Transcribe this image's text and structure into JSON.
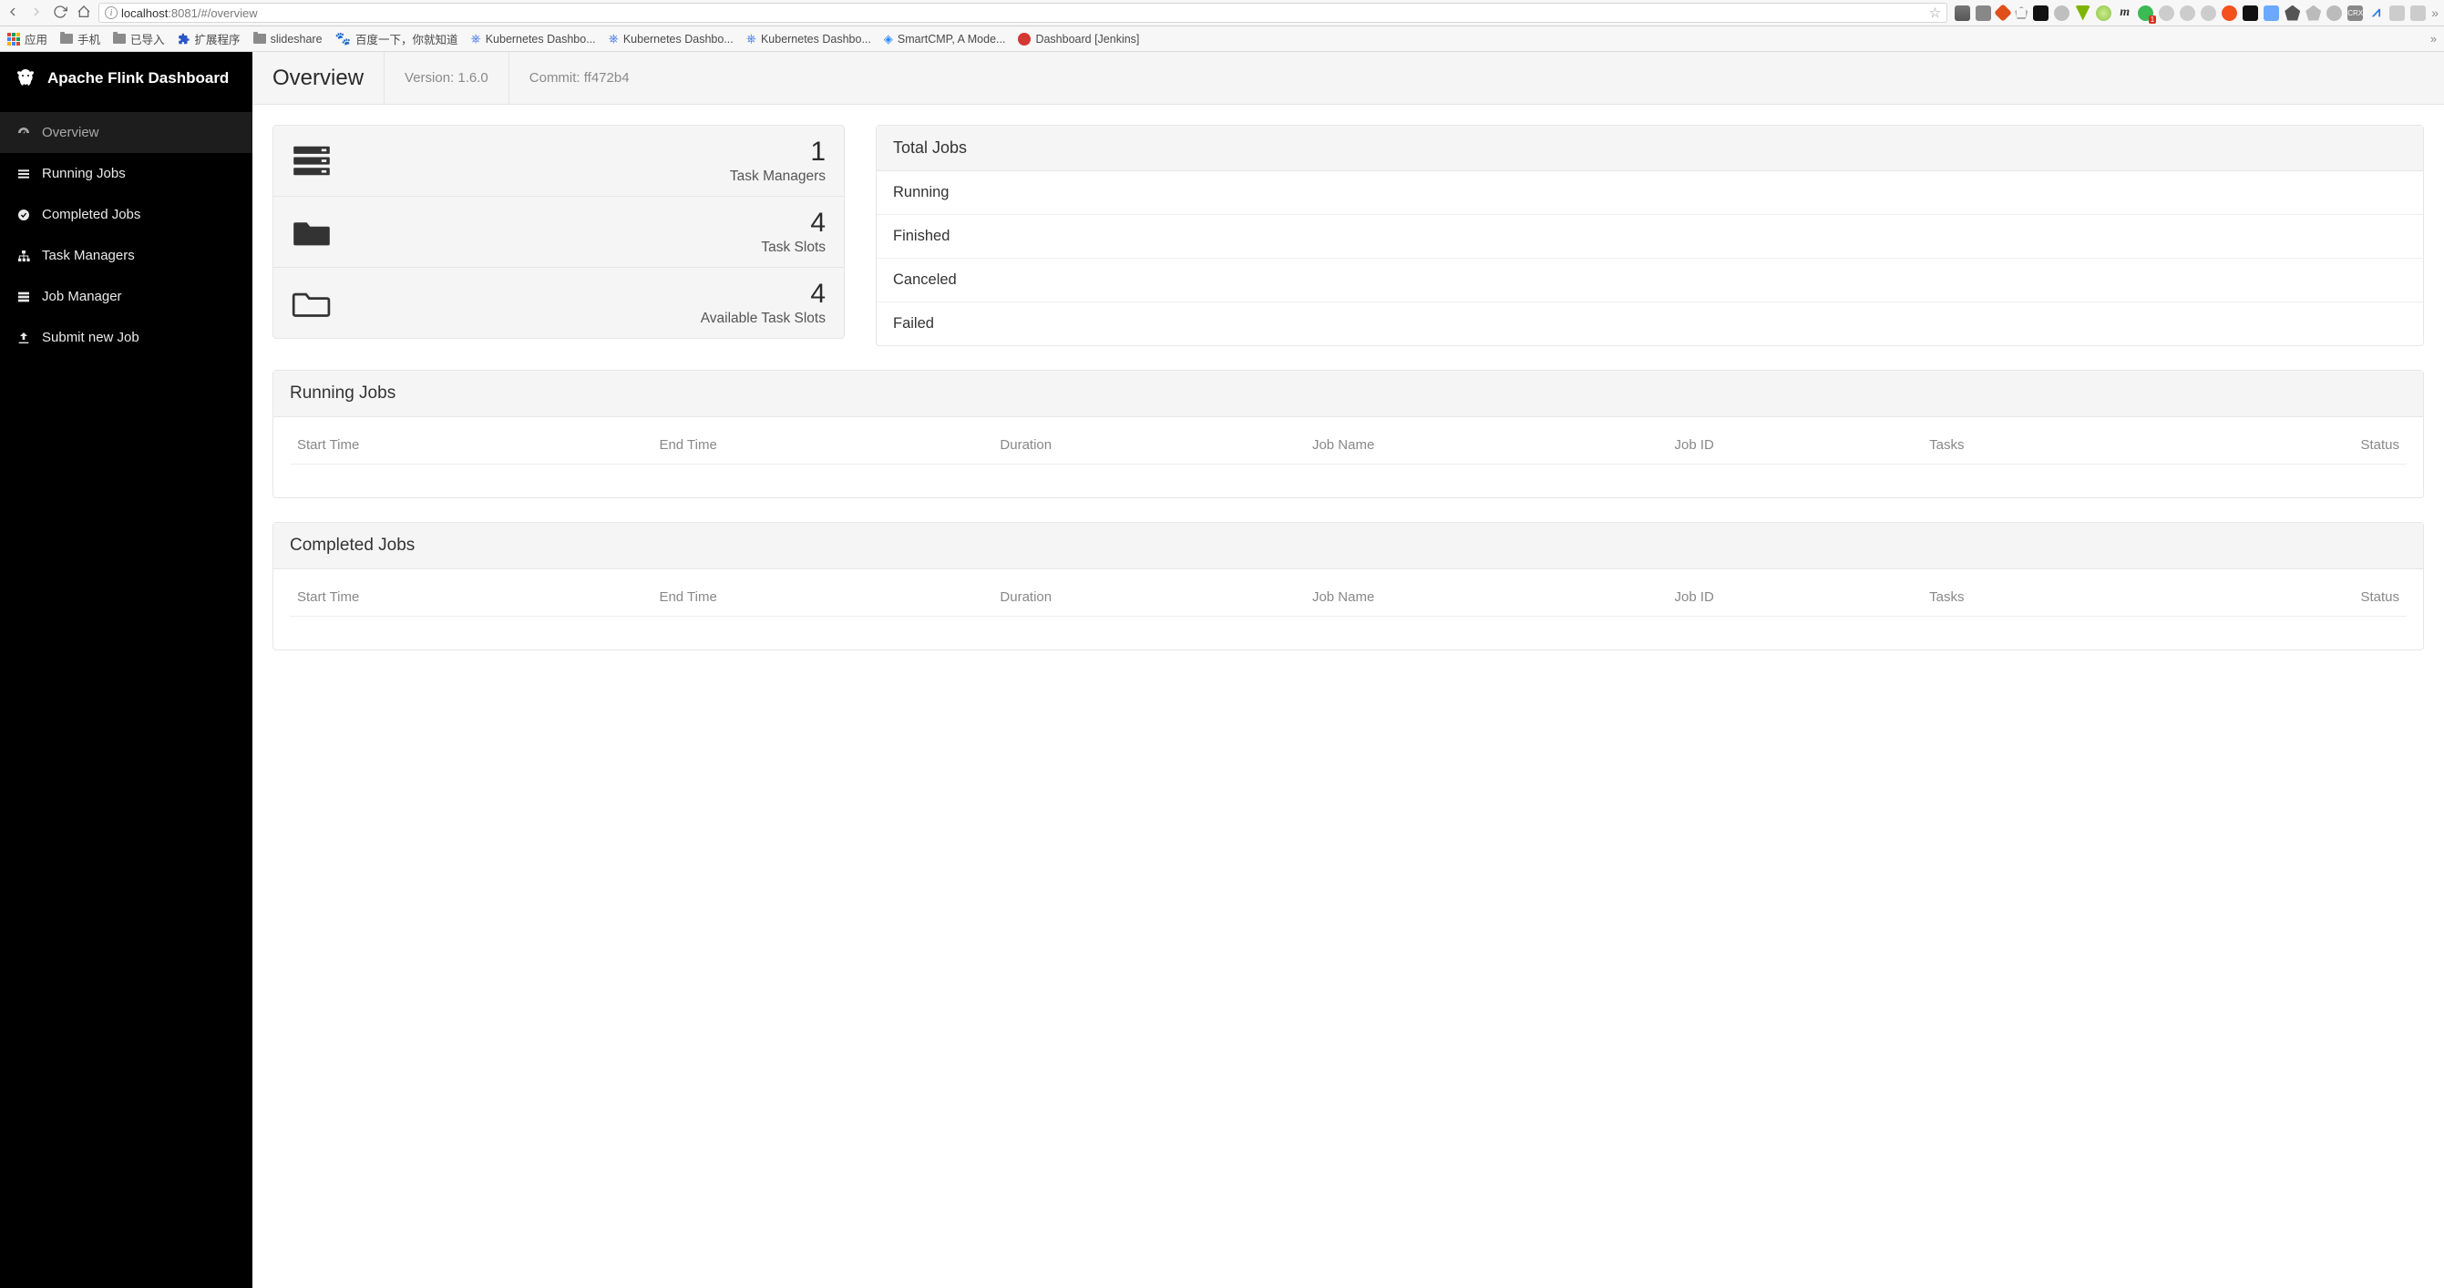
{
  "browser": {
    "url_host": "localhost",
    "url_port": ":8081",
    "url_path": "/#/overview",
    "bookmarks": {
      "apps": "应用",
      "phone": "手机",
      "imported": "已导入",
      "extensions": "扩展程序",
      "slideshare": "slideshare",
      "baidu": "百度一下，你就知道",
      "k8s1": "Kubernetes Dashbo...",
      "k8s2": "Kubernetes Dashbo...",
      "k8s3": "Kubernetes Dashbo...",
      "smartcmp": "SmartCMP, A Mode...",
      "jenkins": "Dashboard [Jenkins]"
    }
  },
  "brand": {
    "title": "Apache Flink Dashboard"
  },
  "sidebar": {
    "items": [
      {
        "label": "Overview"
      },
      {
        "label": "Running Jobs"
      },
      {
        "label": "Completed Jobs"
      },
      {
        "label": "Task Managers"
      },
      {
        "label": "Job Manager"
      },
      {
        "label": "Submit new Job"
      }
    ]
  },
  "topbar": {
    "title": "Overview",
    "version": "Version: 1.6.0",
    "commit": "Commit: ff472b4"
  },
  "stats": {
    "task_managers": {
      "value": "1",
      "label": "Task Managers"
    },
    "task_slots": {
      "value": "4",
      "label": "Task Slots"
    },
    "avail_slots": {
      "value": "4",
      "label": "Available Task Slots"
    }
  },
  "total_jobs": {
    "header": "Total Jobs",
    "rows": [
      "Running",
      "Finished",
      "Canceled",
      "Failed"
    ]
  },
  "table_headers": {
    "start_time": "Start Time",
    "end_time": "End Time",
    "duration": "Duration",
    "job_name": "Job Name",
    "job_id": "Job ID",
    "tasks": "Tasks",
    "status": "Status"
  },
  "panels": {
    "running": "Running Jobs",
    "completed": "Completed Jobs"
  }
}
